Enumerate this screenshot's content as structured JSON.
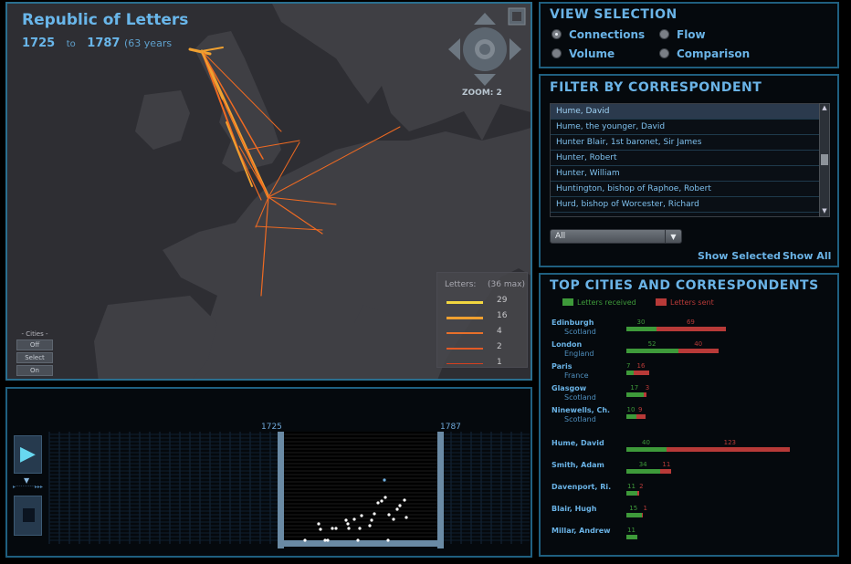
{
  "map": {
    "title": "Republic of Letters",
    "year_start": "1725",
    "to_label": "to",
    "year_end": "1787",
    "span_label": "(63 years",
    "zoom_label": "ZOOM: 2",
    "legend": {
      "header": "Letters:",
      "max": "(36 max)",
      "rows": [
        "29",
        "16",
        "4",
        "2",
        "1"
      ],
      "colors": [
        "#f2d640",
        "#f0a030",
        "#e8702a",
        "#e25a26",
        "#d8401e"
      ]
    },
    "cities_toggle": {
      "title": "- Cities -",
      "buttons": [
        "Off",
        "Select",
        "On"
      ]
    },
    "colors": {
      "land": "#3a3a3f",
      "sea": "#2d2d31",
      "connection_bright": "#f7e05a",
      "connection": "#ef6a22"
    }
  },
  "view_selection": {
    "title": "VIEW SELECTION",
    "options": [
      {
        "label": "Connections",
        "selected": true
      },
      {
        "label": "Flow",
        "selected": false
      },
      {
        "label": "Volume",
        "selected": false
      },
      {
        "label": "Comparison",
        "selected": false
      }
    ]
  },
  "filter": {
    "title": "FILTER BY CORRESPONDENT",
    "items": [
      "Hume, David",
      "Hume, the younger, David",
      "Hunter Blair, 1st baronet, Sir James",
      "Hunter, Robert",
      "Hunter, William",
      "Huntington, bishop of Raphoe, Robert",
      "Hurd, bishop of Worcester, Richard"
    ],
    "selected_index": 0,
    "dropdown_value": "All",
    "show_selected": "Show Selected",
    "show_all": "Show All"
  },
  "top_cities": {
    "title": "TOP CITIES AND CORRESPONDENTS",
    "legend_received": "Letters received",
    "legend_sent": "Letters sent",
    "received_color": "#3e9a3a",
    "sent_color": "#b83a38",
    "cities": [
      {
        "name": "Edinburgh",
        "country": "Scotland",
        "received": 30,
        "sent": 69
      },
      {
        "name": "London",
        "country": "England",
        "received": 52,
        "sent": 40
      },
      {
        "name": "Paris",
        "country": "France",
        "received": 7,
        "sent": 16
      },
      {
        "name": "Glasgow",
        "country": "Scotland",
        "received": 17,
        "sent": 3
      },
      {
        "name": "Ninewells, Ch.",
        "country": "Scotland",
        "received": 10,
        "sent": 9
      }
    ],
    "people": [
      {
        "name": "Hume, David",
        "received": 40,
        "sent": 123
      },
      {
        "name": "Smith, Adam",
        "received": 34,
        "sent": 11
      },
      {
        "name": "Davenport, Ri.",
        "received": 11,
        "sent": 2
      },
      {
        "name": "Blair, Hugh",
        "received": 15,
        "sent": 1
      },
      {
        "name": "Millar, Andrew",
        "received": 11,
        "sent": 0
      }
    ]
  },
  "timeline": {
    "range_start": "1725",
    "range_end": "1787"
  }
}
